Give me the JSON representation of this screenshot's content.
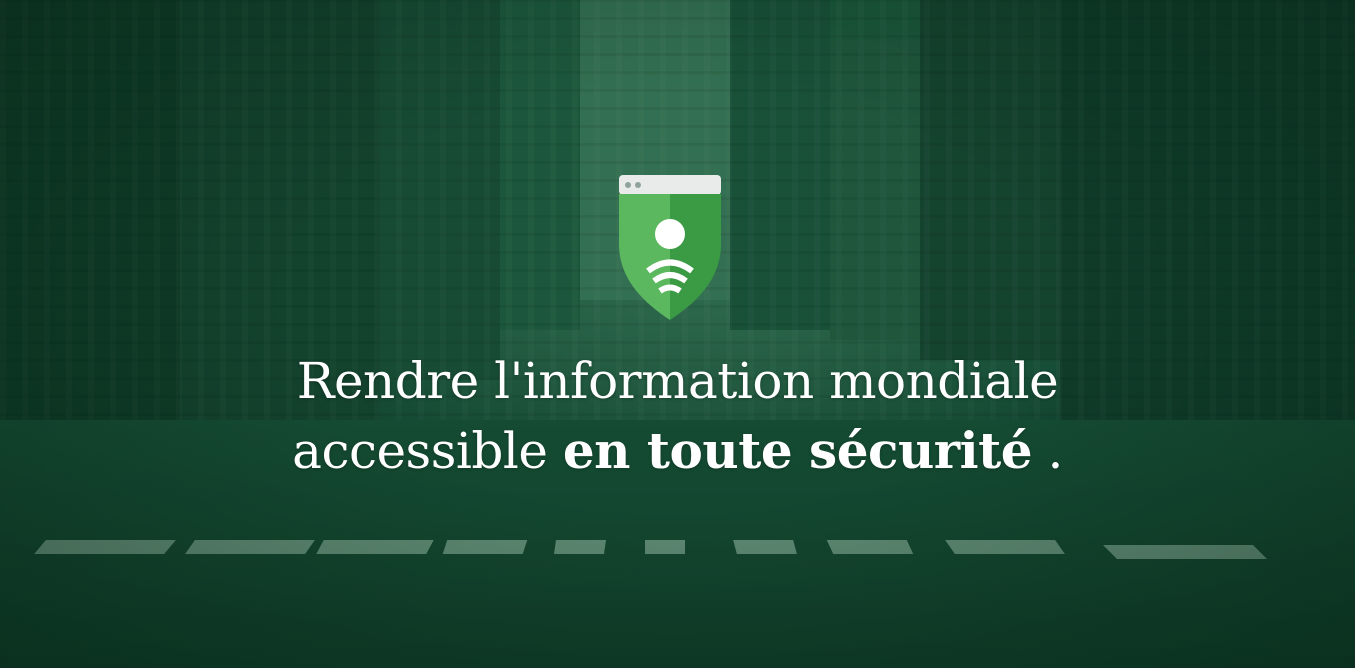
{
  "hero": {
    "logo_icon": "safe-browsing-shield-icon",
    "colors": {
      "overlay": "#1e5a3d",
      "shield_light": "#5cb85f",
      "shield_dark": "#3a9b44",
      "window_bar": "#e8ebe9",
      "text": "#ffffff"
    },
    "headline": {
      "line1": "Rendre l'information mondiale",
      "line2_prefix": "accessible",
      "line2_bold": "en toute sécurité",
      "line2_suffix": "."
    }
  }
}
